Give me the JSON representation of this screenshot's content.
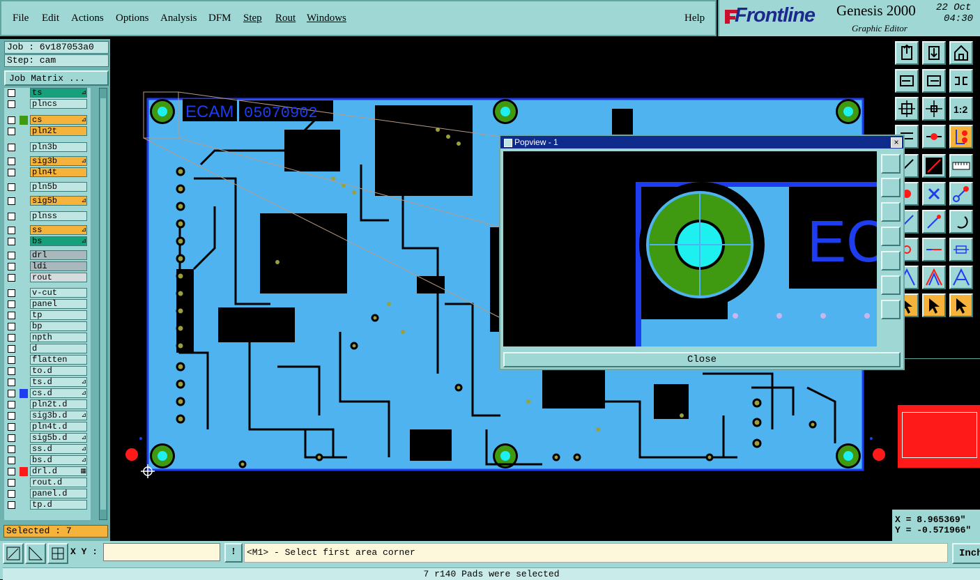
{
  "menu": {
    "items": [
      "File",
      "Edit",
      "Actions",
      "Options",
      "Analysis",
      "DFM",
      "Step",
      "Rout",
      "Windows"
    ],
    "help": "Help"
  },
  "brand": {
    "logo": "Frontline",
    "product": "Genesis 2000",
    "subtitle": "Graphic Editor",
    "date": "22 Oct",
    "time": "04:30"
  },
  "job": {
    "job_line": "Job : 6v187053a0",
    "step_line": "Step: cam",
    "matrix_button": "Job Matrix ..."
  },
  "layers": [
    {
      "name": "ts",
      "color": "#16a07c",
      "mark": "⊿"
    },
    {
      "name": "plncs",
      "color": "#bfe6e3",
      "mark": ""
    },
    {
      "name": "cs",
      "color": "#f5b33b",
      "mark": "⊿"
    },
    {
      "name": "pln2t",
      "color": "#f5b33b",
      "mark": ""
    },
    {
      "name": "pln3b",
      "color": "#bfe6e3",
      "mark": ""
    },
    {
      "name": "sig3b",
      "color": "#f5b33b",
      "mark": "⊿"
    },
    {
      "name": "pln4t",
      "color": "#f5b33b",
      "mark": ""
    },
    {
      "name": "pln5b",
      "color": "#bfe6e3",
      "mark": ""
    },
    {
      "name": "sig5b",
      "color": "#f5b33b",
      "mark": "⊿"
    },
    {
      "name": "plnss",
      "color": "#bfe6e3",
      "mark": ""
    },
    {
      "name": "ss",
      "color": "#f5b33b",
      "mark": "⊿"
    },
    {
      "name": "bs",
      "color": "#16a07c",
      "mark": "⊿"
    },
    {
      "name": "drl",
      "color": "#a8b8bd",
      "mark": ""
    },
    {
      "name": "ldi",
      "color": "#a8b8bd",
      "mark": ""
    },
    {
      "name": "rout",
      "color": "#d5dcdd",
      "mark": ""
    },
    {
      "name": "v-cut",
      "color": "#bfe6e3",
      "mark": ""
    },
    {
      "name": "panel",
      "color": "#bfe6e3",
      "mark": ""
    },
    {
      "name": "tp",
      "color": "#bfe6e3",
      "mark": ""
    },
    {
      "name": "bp",
      "color": "#bfe6e3",
      "mark": ""
    },
    {
      "name": "npth",
      "color": "#bfe6e3",
      "mark": ""
    },
    {
      "name": "d",
      "color": "#bfe6e3",
      "mark": ""
    },
    {
      "name": "flatten",
      "color": "#bfe6e3",
      "mark": ""
    },
    {
      "name": "to.d",
      "color": "#bfe6e3",
      "mark": ""
    },
    {
      "name": "ts.d",
      "color": "#bfe6e3",
      "mark": "⊿"
    },
    {
      "name": "cs.d",
      "color": "#bfe6e3",
      "mark": "⊿"
    },
    {
      "name": "pln2t.d",
      "color": "#bfe6e3",
      "mark": ""
    },
    {
      "name": "sig3b.d",
      "color": "#bfe6e3",
      "mark": "⊿"
    },
    {
      "name": "pln4t.d",
      "color": "#bfe6e3",
      "mark": ""
    },
    {
      "name": "sig5b.d",
      "color": "#bfe6e3",
      "mark": "⊿"
    },
    {
      "name": "ss.d",
      "color": "#bfe6e3",
      "mark": "⊿"
    },
    {
      "name": "bs.d",
      "color": "#bfe6e3",
      "mark": "⊿"
    },
    {
      "name": "drl.d",
      "color": "#bfe6e3",
      "mark": "▦"
    },
    {
      "name": "rout.d",
      "color": "#bfe6e3",
      "mark": ""
    },
    {
      "name": "panel.d",
      "color": "#bfe6e3",
      "mark": ""
    },
    {
      "name": "tp.d",
      "color": "#bfe6e3",
      "mark": ""
    }
  ],
  "selected_label": "Selected : 7",
  "board": {
    "silk_text_1": "ECAM",
    "silk_text_2": "05070902"
  },
  "popview": {
    "title": "Popview - 1",
    "zoom_text": "EC",
    "close_label": "Close"
  },
  "coords": {
    "x": "X = 8.965369\"",
    "y": "Y = -0.571966\""
  },
  "bottom": {
    "xy_label": "X Y :",
    "xy_value": "",
    "prompt": "<M1> - Select first area corner",
    "units_button": "Inch",
    "status": "7 r140 Pads were selected"
  },
  "colors": {
    "ui_bg": "#9ed7d4",
    "board_blue": "#4fb3ef",
    "outline_blue": "#1f3df0",
    "pad_green": "#3f9a12",
    "pad_cyan": "#1ef0f0",
    "selected_red": "#ff1a1a",
    "highlight_orange": "#f5b33b"
  }
}
